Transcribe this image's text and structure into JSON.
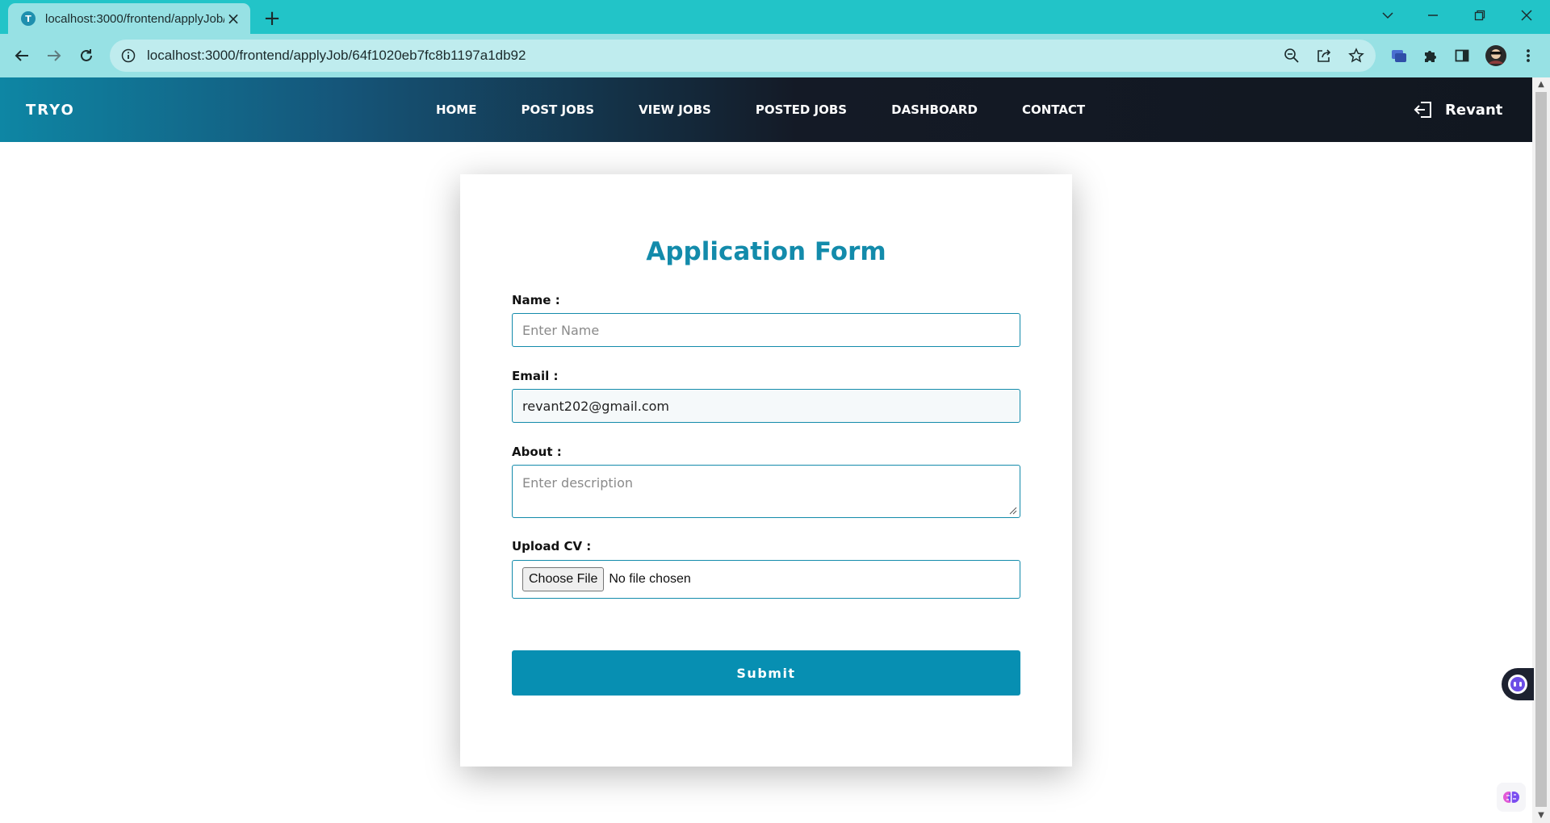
{
  "browser": {
    "tab": {
      "favicon_letter": "T",
      "title": "localhost:3000/frontend/applyJob/64f1020eb7fc8b1197a1db92"
    },
    "new_tab_icon": "plus-icon",
    "url": "localhost:3000/frontend/applyJob/64f1020eb7fc8b1197a1db92",
    "window_controls": [
      "tab-search-icon",
      "minimize-icon",
      "restore-icon",
      "close-icon"
    ],
    "toolbar_icons": [
      "back-arrow-icon",
      "forward-arrow-icon",
      "reload-icon",
      "site-info-icon",
      "zoom-out-icon",
      "share-icon",
      "bookmark-star-icon",
      "extension-icon",
      "puzzle-icon",
      "side-panel-icon",
      "profile-avatar",
      "menu-kebab-icon"
    ]
  },
  "navbar": {
    "brand": "TRYO",
    "links": [
      "HOME",
      "POST JOBS",
      "VIEW JOBS",
      "POSTED JOBS",
      "DASHBOARD",
      "CONTACT"
    ],
    "user": {
      "icon": "logout-icon",
      "name": "Revant"
    }
  },
  "form": {
    "title": "Application Form",
    "name": {
      "label": "Name :",
      "placeholder": "Enter Name",
      "value": ""
    },
    "email": {
      "label": "Email :",
      "value": "revant202@gmail.com"
    },
    "about": {
      "label": "About :",
      "placeholder": "Enter description",
      "value": ""
    },
    "cv": {
      "label": "Upload CV :",
      "button": "Choose File",
      "status": "No file chosen"
    },
    "submit": "Submit"
  },
  "colors": {
    "browser_frame": "#22c4c8",
    "accent": "#138bab",
    "submit_bg": "#078fb2",
    "navbar_dark": "#111720"
  }
}
